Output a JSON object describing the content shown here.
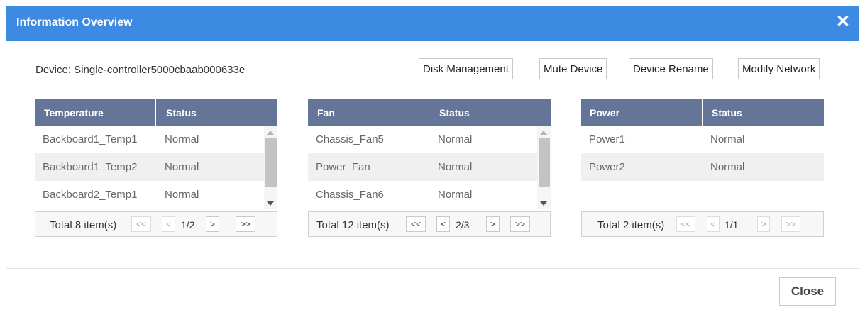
{
  "dialog": {
    "title": "Information Overview",
    "close_glyph": "✕"
  },
  "device": {
    "label": "Device: Single-controller5000cbaab000633e"
  },
  "actions": {
    "disk": "Disk Management",
    "mute": "Mute Device",
    "rename": "Device Rename",
    "network": "Modify Network"
  },
  "temperature": {
    "headers": [
      "Temperature",
      "Status"
    ],
    "rows": [
      [
        "Backboard1_Temp1",
        "Normal"
      ],
      [
        "Backboard1_Temp2",
        "Normal"
      ],
      [
        "Backboard2_Temp1",
        "Normal"
      ]
    ],
    "total": "Total 8 item(s)",
    "page": "1/2"
  },
  "fan": {
    "headers": [
      "Fan",
      "Status"
    ],
    "rows": [
      [
        "Chassis_Fan5",
        "Normal"
      ],
      [
        "Power_Fan",
        "Normal"
      ],
      [
        "Chassis_Fan6",
        "Normal"
      ]
    ],
    "total": "Total 12 item(s)",
    "page": "2/3"
  },
  "power": {
    "headers": [
      "Power",
      "Status"
    ],
    "rows": [
      [
        "Power1",
        "Normal"
      ],
      [
        "Power2",
        "Normal"
      ]
    ],
    "total": "Total 2 item(s)",
    "page": "1/1"
  },
  "pager_labels": {
    "first": "<<",
    "prev": "<",
    "next": ">",
    "last": ">>"
  },
  "footer": {
    "close": "Close"
  },
  "colors": {
    "titlebar": "#3d8ae3",
    "grid_header": "#657597"
  }
}
